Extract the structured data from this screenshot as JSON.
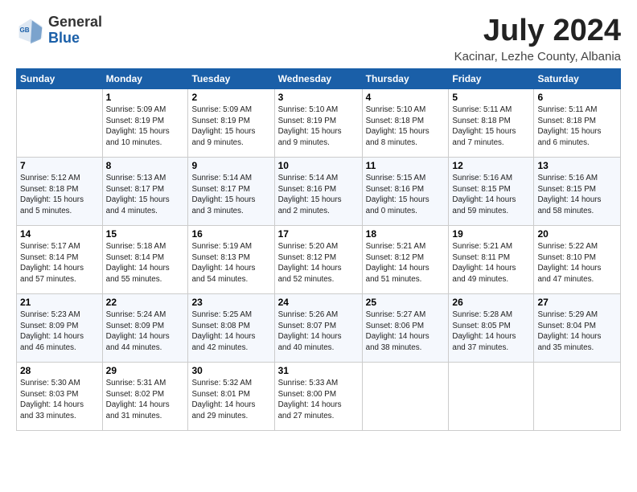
{
  "logo": {
    "general": "General",
    "blue": "Blue"
  },
  "title": "July 2024",
  "location": "Kacinar, Lezhe County, Albania",
  "days_of_week": [
    "Sunday",
    "Monday",
    "Tuesday",
    "Wednesday",
    "Thursday",
    "Friday",
    "Saturday"
  ],
  "weeks": [
    [
      {
        "day": "",
        "info": ""
      },
      {
        "day": "1",
        "info": "Sunrise: 5:09 AM\nSunset: 8:19 PM\nDaylight: 15 hours\nand 10 minutes."
      },
      {
        "day": "2",
        "info": "Sunrise: 5:09 AM\nSunset: 8:19 PM\nDaylight: 15 hours\nand 9 minutes."
      },
      {
        "day": "3",
        "info": "Sunrise: 5:10 AM\nSunset: 8:19 PM\nDaylight: 15 hours\nand 9 minutes."
      },
      {
        "day": "4",
        "info": "Sunrise: 5:10 AM\nSunset: 8:18 PM\nDaylight: 15 hours\nand 8 minutes."
      },
      {
        "day": "5",
        "info": "Sunrise: 5:11 AM\nSunset: 8:18 PM\nDaylight: 15 hours\nand 7 minutes."
      },
      {
        "day": "6",
        "info": "Sunrise: 5:11 AM\nSunset: 8:18 PM\nDaylight: 15 hours\nand 6 minutes."
      }
    ],
    [
      {
        "day": "7",
        "info": "Sunrise: 5:12 AM\nSunset: 8:18 PM\nDaylight: 15 hours\nand 5 minutes."
      },
      {
        "day": "8",
        "info": "Sunrise: 5:13 AM\nSunset: 8:17 PM\nDaylight: 15 hours\nand 4 minutes."
      },
      {
        "day": "9",
        "info": "Sunrise: 5:14 AM\nSunset: 8:17 PM\nDaylight: 15 hours\nand 3 minutes."
      },
      {
        "day": "10",
        "info": "Sunrise: 5:14 AM\nSunset: 8:16 PM\nDaylight: 15 hours\nand 2 minutes."
      },
      {
        "day": "11",
        "info": "Sunrise: 5:15 AM\nSunset: 8:16 PM\nDaylight: 15 hours\nand 0 minutes."
      },
      {
        "day": "12",
        "info": "Sunrise: 5:16 AM\nSunset: 8:15 PM\nDaylight: 14 hours\nand 59 minutes."
      },
      {
        "day": "13",
        "info": "Sunrise: 5:16 AM\nSunset: 8:15 PM\nDaylight: 14 hours\nand 58 minutes."
      }
    ],
    [
      {
        "day": "14",
        "info": "Sunrise: 5:17 AM\nSunset: 8:14 PM\nDaylight: 14 hours\nand 57 minutes."
      },
      {
        "day": "15",
        "info": "Sunrise: 5:18 AM\nSunset: 8:14 PM\nDaylight: 14 hours\nand 55 minutes."
      },
      {
        "day": "16",
        "info": "Sunrise: 5:19 AM\nSunset: 8:13 PM\nDaylight: 14 hours\nand 54 minutes."
      },
      {
        "day": "17",
        "info": "Sunrise: 5:20 AM\nSunset: 8:12 PM\nDaylight: 14 hours\nand 52 minutes."
      },
      {
        "day": "18",
        "info": "Sunrise: 5:21 AM\nSunset: 8:12 PM\nDaylight: 14 hours\nand 51 minutes."
      },
      {
        "day": "19",
        "info": "Sunrise: 5:21 AM\nSunset: 8:11 PM\nDaylight: 14 hours\nand 49 minutes."
      },
      {
        "day": "20",
        "info": "Sunrise: 5:22 AM\nSunset: 8:10 PM\nDaylight: 14 hours\nand 47 minutes."
      }
    ],
    [
      {
        "day": "21",
        "info": "Sunrise: 5:23 AM\nSunset: 8:09 PM\nDaylight: 14 hours\nand 46 minutes."
      },
      {
        "day": "22",
        "info": "Sunrise: 5:24 AM\nSunset: 8:09 PM\nDaylight: 14 hours\nand 44 minutes."
      },
      {
        "day": "23",
        "info": "Sunrise: 5:25 AM\nSunset: 8:08 PM\nDaylight: 14 hours\nand 42 minutes."
      },
      {
        "day": "24",
        "info": "Sunrise: 5:26 AM\nSunset: 8:07 PM\nDaylight: 14 hours\nand 40 minutes."
      },
      {
        "day": "25",
        "info": "Sunrise: 5:27 AM\nSunset: 8:06 PM\nDaylight: 14 hours\nand 38 minutes."
      },
      {
        "day": "26",
        "info": "Sunrise: 5:28 AM\nSunset: 8:05 PM\nDaylight: 14 hours\nand 37 minutes."
      },
      {
        "day": "27",
        "info": "Sunrise: 5:29 AM\nSunset: 8:04 PM\nDaylight: 14 hours\nand 35 minutes."
      }
    ],
    [
      {
        "day": "28",
        "info": "Sunrise: 5:30 AM\nSunset: 8:03 PM\nDaylight: 14 hours\nand 33 minutes."
      },
      {
        "day": "29",
        "info": "Sunrise: 5:31 AM\nSunset: 8:02 PM\nDaylight: 14 hours\nand 31 minutes."
      },
      {
        "day": "30",
        "info": "Sunrise: 5:32 AM\nSunset: 8:01 PM\nDaylight: 14 hours\nand 29 minutes."
      },
      {
        "day": "31",
        "info": "Sunrise: 5:33 AM\nSunset: 8:00 PM\nDaylight: 14 hours\nand 27 minutes."
      },
      {
        "day": "",
        "info": ""
      },
      {
        "day": "",
        "info": ""
      },
      {
        "day": "",
        "info": ""
      }
    ]
  ]
}
